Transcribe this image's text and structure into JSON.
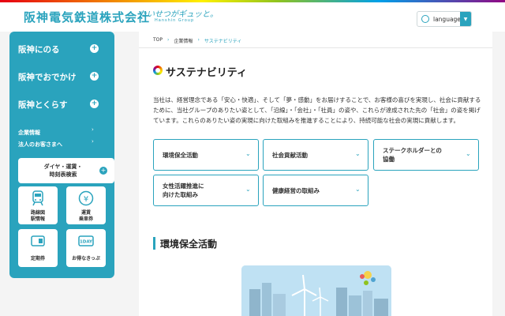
{
  "header": {
    "logo": "阪神電気鉄道株式会社",
    "slogan": "たいせつがギュッと。",
    "slogan_sub": "Hanshin Group",
    "language_label": "language"
  },
  "sidebar": {
    "main_items": [
      {
        "label": "阪神にのる"
      },
      {
        "label": "阪神でおでかけ"
      },
      {
        "label": "阪神とくらす"
      }
    ],
    "sub_items": [
      {
        "label": "企業情報"
      },
      {
        "label": "法人のお客さまへ"
      }
    ],
    "timetable_button": {
      "line1": "ダイヤ・運賃・",
      "line2": "時刻表検索"
    },
    "tiles": [
      {
        "line1": "路線図",
        "line2": "駅情報"
      },
      {
        "line1": "運賃",
        "line2": "乗車券"
      },
      {
        "line1": "定期券",
        "line2": ""
      },
      {
        "line1": "お得なきっぷ",
        "line2": "",
        "badge": "1DAY"
      }
    ]
  },
  "breadcrumb": {
    "home": "TOP",
    "parent": "企業情報",
    "current": "サステナビリティ"
  },
  "main": {
    "title": "サステナビリティ",
    "intro": "当社は、経営理念である「安心・快適」、そして「夢・感動」をお届けすることで、お客様の喜びを実現し、社会に貢献するために、当社グループのありたい姿として、「沿線」・「会社」・「社員」の姿や、これらが達成された先の「社会」の姿を掲げています。これらのありたい姿の実現に向けた取組みを推進することにより、持続可能な社会の実現に貢献します。",
    "cards": [
      {
        "line1": "環境保全活動",
        "line2": ""
      },
      {
        "line1": "社会貢献活動",
        "line2": ""
      },
      {
        "line1": "ステークホルダーとの",
        "line2": "協働"
      },
      {
        "line1": "女性活躍推進に",
        "line2": "向けた取組み"
      },
      {
        "line1": "健康経営の取組み",
        "line2": ""
      }
    ],
    "section_title": "環境保全活動"
  },
  "colors": {
    "accent": "#2aa3bd",
    "text": "#333333",
    "background": "#f4f4f4"
  }
}
